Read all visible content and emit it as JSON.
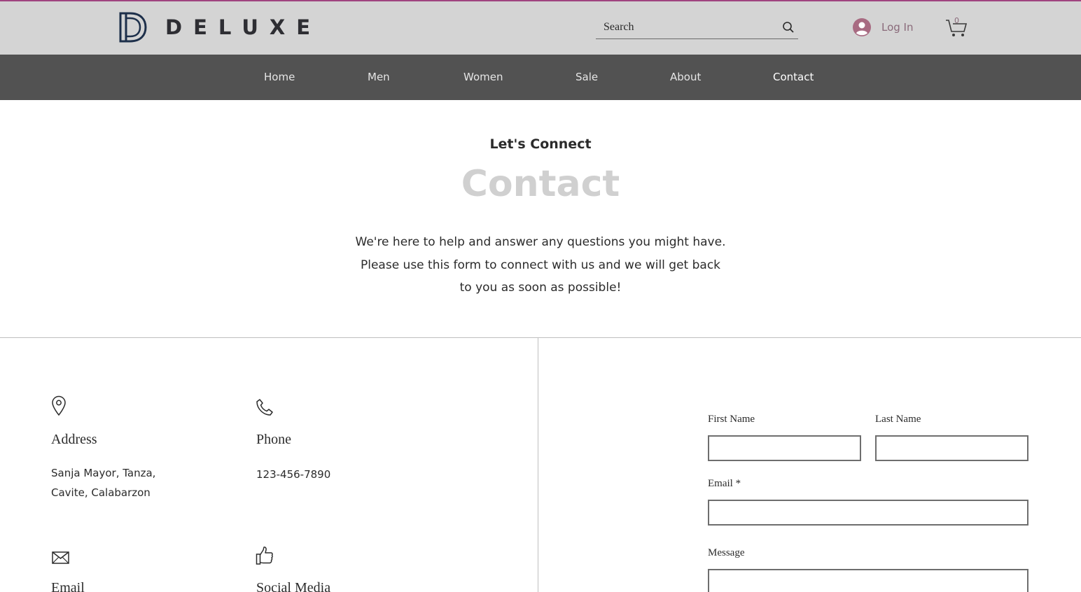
{
  "header": {
    "brand_name": "DELUXE",
    "search": {
      "placeholder": "Search"
    },
    "login_label": "Log In",
    "cart_count": "0"
  },
  "nav": {
    "items": [
      {
        "label": "Home"
      },
      {
        "label": "Men"
      },
      {
        "label": "Women"
      },
      {
        "label": "Sale"
      },
      {
        "label": "About"
      },
      {
        "label": "Contact",
        "active": true
      }
    ]
  },
  "hero": {
    "eyebrow": "Let's Connect",
    "title": "Contact",
    "lines": [
      "We're here to help and answer any questions you might have.",
      "Please use this form to connect with us and we will get back",
      "to you as soon as possible!"
    ]
  },
  "info": {
    "address": {
      "icon": "map-pin-icon",
      "heading": "Address",
      "lines": [
        "Sanja Mayor, Tanza,",
        "Cavite, Calabarzon"
      ]
    },
    "phone": {
      "icon": "phone-icon",
      "heading": "Phone",
      "value": "123-456-7890"
    },
    "email": {
      "icon": "envelope-icon",
      "heading": "Email"
    },
    "social": {
      "icon": "thumbs-up-icon",
      "heading": "Social Media"
    }
  },
  "form": {
    "first_name_label": "First Name",
    "last_name_label": "Last Name",
    "email_label": "Email *",
    "message_label": "Message"
  },
  "colors": {
    "header_bg": "#d4d4d4",
    "nav_bg": "#525252",
    "accent_line": "#a0447f",
    "title_gray": "#d0d0d0"
  }
}
